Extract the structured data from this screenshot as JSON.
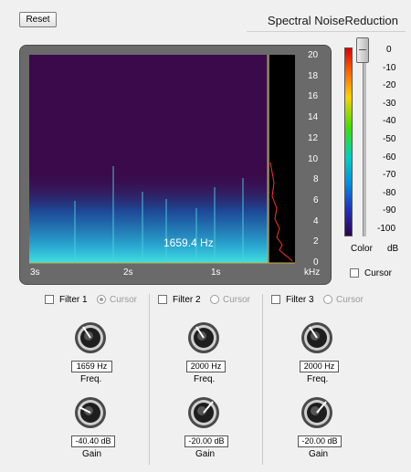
{
  "toolbar": {
    "reset_label": "Reset"
  },
  "header": {
    "title": "Spectral NoiseReduction"
  },
  "spectrogram": {
    "freq_ticks": [
      "20",
      "18",
      "16",
      "14",
      "12",
      "10",
      "8",
      "6",
      "4",
      "2",
      "0"
    ],
    "time_ticks": [
      "3s",
      "2s",
      "1s"
    ],
    "freq_unit": "kHz",
    "cursor_readout": "1659.4 Hz"
  },
  "meter": {
    "db_ticks": [
      "0",
      "-10",
      "-20",
      "-30",
      "-40",
      "-50",
      "-60",
      "-70",
      "-80",
      "-90",
      "-100"
    ],
    "color_label": "Color",
    "db_label": "dB",
    "slider_level": 0.0
  },
  "cursor_toggle": {
    "label": "Cursor",
    "checked": false
  },
  "filters": [
    {
      "label": "Filter 1",
      "cursor_label": "Cursor",
      "enabled": false,
      "cursor_selected": true,
      "freq_value": "1659 Hz",
      "freq_label": "Freq.",
      "gain_value": "-40.40 dB",
      "gain_label": "Gain"
    },
    {
      "label": "Filter 2",
      "cursor_label": "Cursor",
      "enabled": false,
      "cursor_selected": false,
      "freq_value": "2000 Hz",
      "freq_label": "Freq.",
      "gain_value": "-20.00 dB",
      "gain_label": "Gain"
    },
    {
      "label": "Filter 3",
      "cursor_label": "Cursor",
      "enabled": false,
      "cursor_selected": false,
      "freq_value": "2000 Hz",
      "freq_label": "Freq.",
      "gain_value": "-20.00 dB",
      "gain_label": "Gain"
    }
  ],
  "colors": {
    "spec_background": "#3b0a4a",
    "meter_frame": "#6a6a6a",
    "cursor_line": "#c8b040",
    "spectrum_trace": "#ff3030"
  }
}
